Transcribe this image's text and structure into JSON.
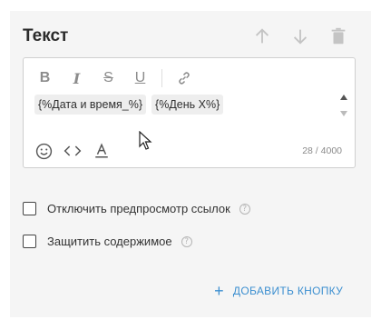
{
  "card": {
    "title": "Текст"
  },
  "header_actions": [
    {
      "icon": "arrow-up-icon",
      "color": "#c4c4c4"
    },
    {
      "icon": "arrow-down-icon",
      "color": "#c4c4c4"
    },
    {
      "icon": "trash-icon",
      "color": "#c4c4c4"
    }
  ],
  "editor": {
    "format": {
      "bold": "B",
      "italic": "I",
      "strike": "S",
      "underline": "U",
      "link_icon": "link-icon"
    },
    "tags": [
      "{%Дата и время_%}",
      "{%День X%}"
    ],
    "counter": "28 / 4000",
    "bottom_icons": [
      "emoji-icon",
      "code-icon",
      "text-color-icon"
    ]
  },
  "options": {
    "disable_preview": "Отключить предпросмотр ссылок",
    "protect_content": "Защитить содержимое",
    "help_glyph": "?"
  },
  "add_button": {
    "plus": "+",
    "label": "ДОБАВИТЬ КНОПКУ",
    "color": "#3c8fd0"
  }
}
